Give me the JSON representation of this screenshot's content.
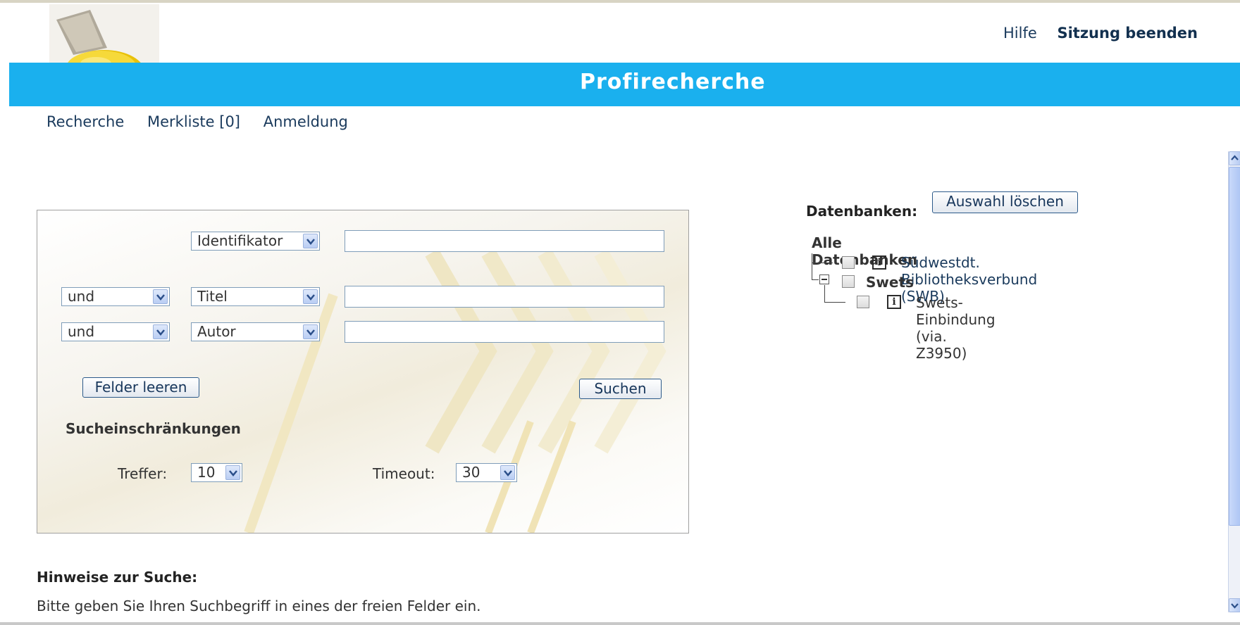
{
  "header": {
    "title": "Profirecherche",
    "help_label": "Hilfe",
    "logout_label": "Sitzung beenden",
    "accent_color": "#1ab0ee"
  },
  "nav": {
    "items": [
      "Recherche",
      "Merkliste [0]",
      "Anmeldung"
    ]
  },
  "search_form": {
    "rows": [
      {
        "operator": "",
        "field": "Identifikator",
        "value": ""
      },
      {
        "operator": "und",
        "field": "Titel",
        "value": ""
      },
      {
        "operator": "und",
        "field": "Autor",
        "value": ""
      }
    ],
    "clear_button": "Felder leeren",
    "search_button": "Suchen",
    "restrictions_heading": "Sucheinschränkungen",
    "hits_label": "Treffer:",
    "hits_value": "10",
    "timeout_label": "Timeout:",
    "timeout_value": "30"
  },
  "hints": {
    "heading": "Hinweise zur Suche:",
    "text": "Bitte geben Sie Ihren Suchbegriff in eines der freien Felder ein."
  },
  "databases": {
    "label": "Datenbanken:",
    "clear_selection_button": "Auswahl löschen",
    "root": "Alle Datenbanken",
    "items": [
      {
        "name": "Südwestdt. Bibliotheksverbund (SWB)",
        "checked": false
      },
      {
        "name": "Swets",
        "checked": false
      },
      {
        "name": "Swets-Einbindung (via. Z3950)",
        "checked": false
      }
    ]
  }
}
